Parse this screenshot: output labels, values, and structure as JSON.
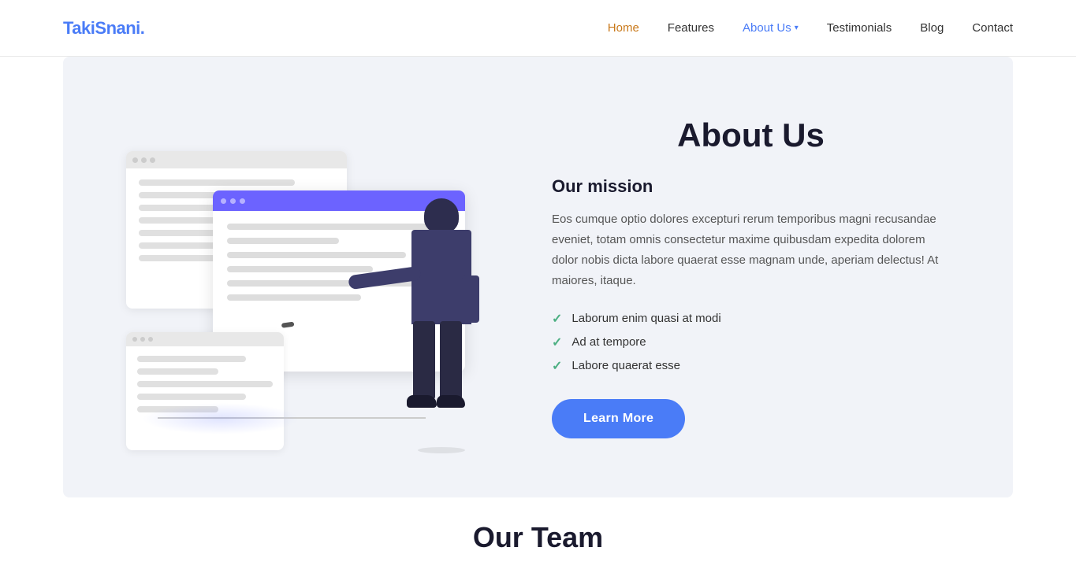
{
  "logo": {
    "text_main": "TakiSnani",
    "text_accent": "."
  },
  "nav": {
    "items": [
      {
        "label": "Home",
        "class": "home",
        "active": false
      },
      {
        "label": "Features",
        "class": "",
        "active": false
      },
      {
        "label": "About Us",
        "class": "active",
        "active": true,
        "has_dropdown": true
      },
      {
        "label": "Testimonials",
        "class": "",
        "active": false
      },
      {
        "label": "Blog",
        "class": "",
        "active": false
      },
      {
        "label": "Contact",
        "class": "",
        "active": false
      }
    ]
  },
  "about": {
    "section_title": "About Us",
    "mission": {
      "title": "Our mission",
      "body": "Eos cumque optio dolores excepturi rerum temporibus magni recusandae eveniet, totam omnis consectetur maxime quibusdam expedita dolorem dolor nobis dicta labore quaerat esse magnam unde, aperiam delectus! At maiores, itaque.",
      "checklist": [
        "Laborum enim quasi at modi",
        "Ad at tempore",
        "Labore quaerat esse"
      ]
    },
    "cta_label": "Learn More"
  },
  "team_section": {
    "title": "Our Team"
  }
}
